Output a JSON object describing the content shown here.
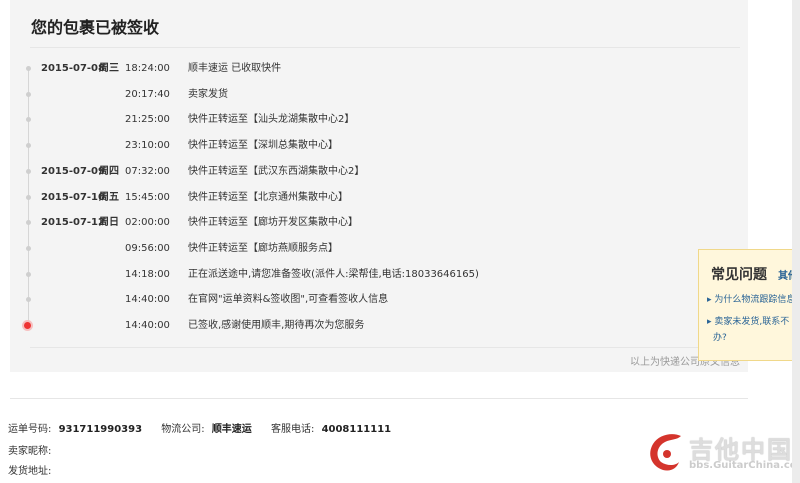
{
  "title": "您的包裹已被签收",
  "timeline": [
    {
      "date": "2015-07-08",
      "weekday": "周三",
      "time": "18:24:00",
      "desc": "顺丰速运 已收取快件"
    },
    {
      "date": "",
      "weekday": "",
      "time": "20:17:40",
      "desc": "卖家发货"
    },
    {
      "date": "",
      "weekday": "",
      "time": "21:25:00",
      "desc": "快件正转运至【汕头龙湖集散中心2】"
    },
    {
      "date": "",
      "weekday": "",
      "time": "23:10:00",
      "desc": "快件正转运至【深圳总集散中心】"
    },
    {
      "date": "2015-07-09",
      "weekday": "周四",
      "time": "07:32:00",
      "desc": "快件正转运至【武汉东西湖集散中心2】"
    },
    {
      "date": "2015-07-10",
      "weekday": "周五",
      "time": "15:45:00",
      "desc": "快件正转运至【北京通州集散中心】"
    },
    {
      "date": "2015-07-12",
      "weekday": "周日",
      "time": "02:00:00",
      "desc": "快件正转运至【廊坊开发区集散中心】"
    },
    {
      "date": "",
      "weekday": "",
      "time": "09:56:00",
      "desc": "快件正转运至【廊坊燕顺服务点】"
    },
    {
      "date": "",
      "weekday": "",
      "time": "14:18:00",
      "desc": "正在派送途中,请您准备签收(派件人:梁帮佳,电话:18033646165)"
    },
    {
      "date": "",
      "weekday": "",
      "time": "14:40:00",
      "desc": "在官网\"运单资料&签收图\",可查看签收人信息"
    },
    {
      "date": "",
      "weekday": "",
      "time": "14:40:00",
      "desc": "已签收,感谢使用顺丰,期待再次为您服务"
    }
  ],
  "footnote": "以上为快递公司原文信息",
  "info": {
    "waybill_label": "运单号码:",
    "waybill_value": "931711990393",
    "carrier_label": "物流公司:",
    "carrier_value": "顺丰速运",
    "phone_label": "客服电话:",
    "phone_value": "4008111111",
    "seller_label": "卖家昵称:",
    "address_label": "发货地址:"
  },
  "faq": {
    "title": "常见问题",
    "more": "其他",
    "items": [
      "为什么物流跟踪信息",
      "卖家未发货,联系不",
      "办?"
    ]
  },
  "watermark": {
    "text": "吉他中国",
    "url": "bbs.GuitarChina.com"
  },
  "colors": {
    "current_dot": "#ee3333",
    "panel_bg": "#f4f4f4",
    "faq_bg": "#fff7dc",
    "link": "#2a6496"
  }
}
